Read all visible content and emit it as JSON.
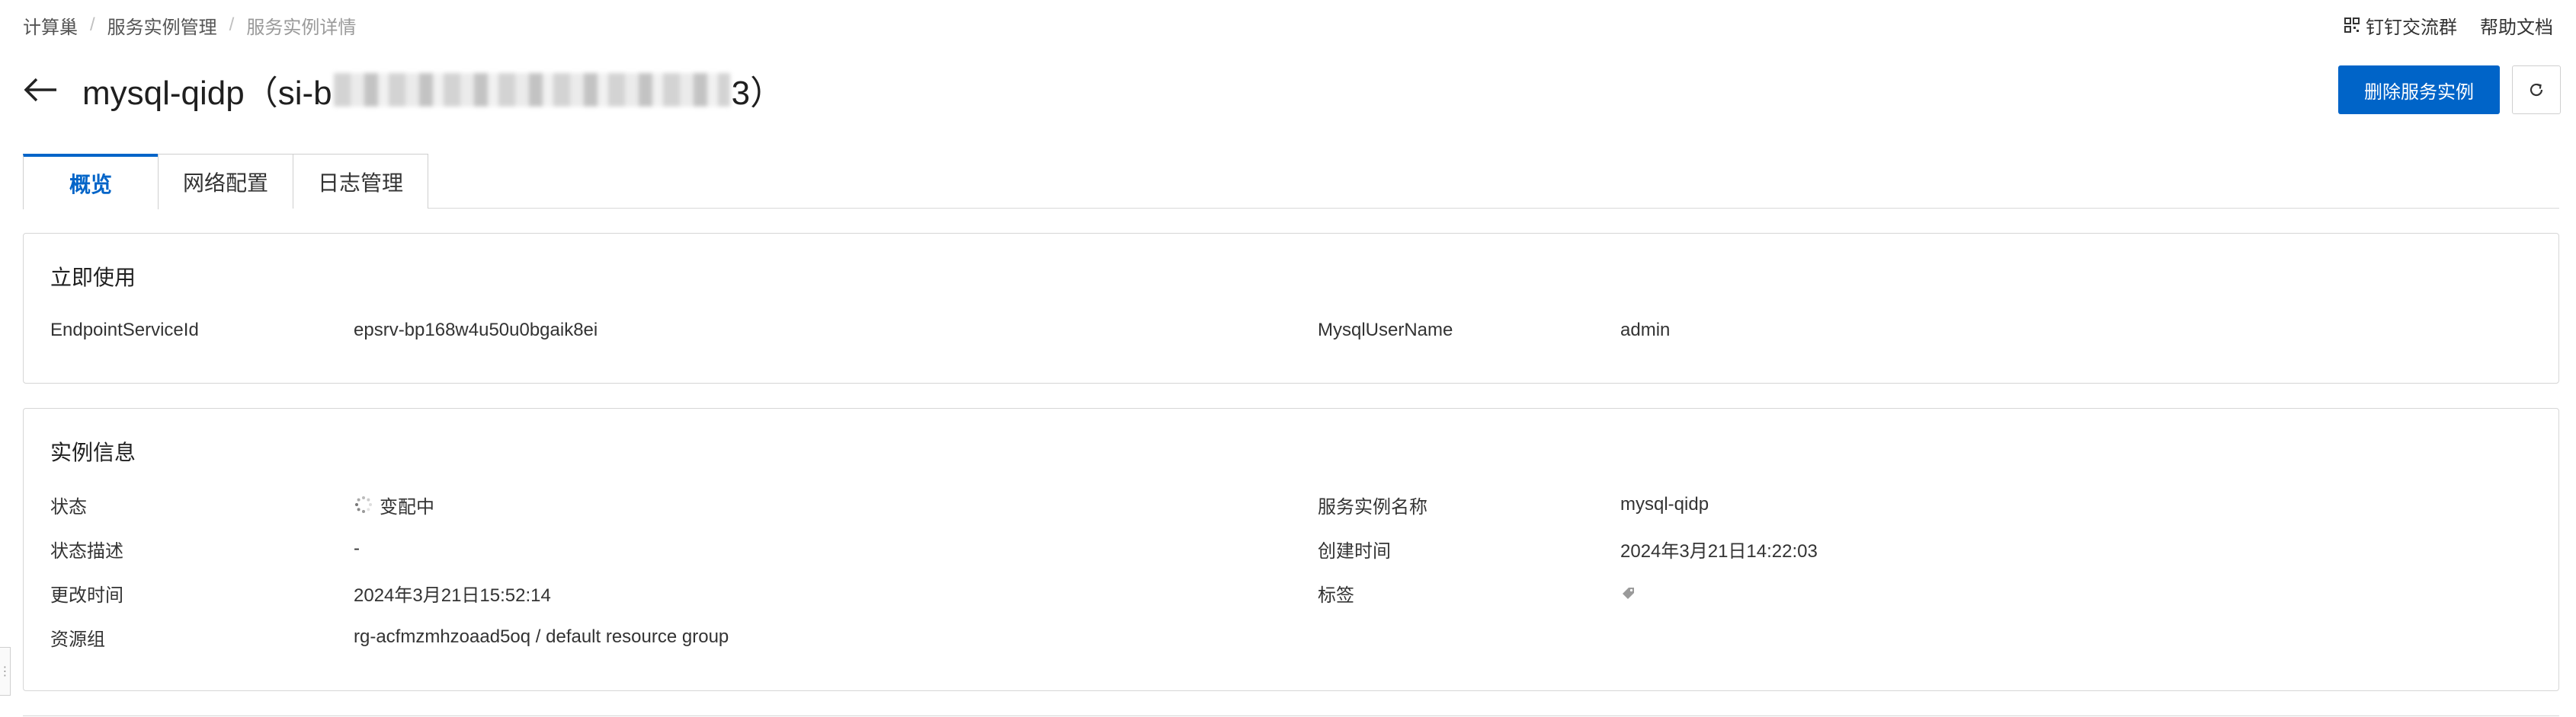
{
  "breadcrumb": {
    "items": [
      "计算巢",
      "服务实例管理",
      "服务实例详情"
    ],
    "separator": "/"
  },
  "top_links": {
    "dingtalk": "钉钉交流群",
    "help": "帮助文档"
  },
  "header": {
    "title_prefix": "mysql-qidp（si-b",
    "title_suffix": "3）",
    "delete_label": "删除服务实例",
    "accent_color": "#0064c8"
  },
  "tabs": [
    {
      "label": "概览",
      "active": true
    },
    {
      "label": "网络配置",
      "active": false
    },
    {
      "label": "日志管理",
      "active": false
    }
  ],
  "quick_use": {
    "title": "立即使用",
    "endpoint_label": "EndpointServiceId",
    "endpoint_value": "epsrv-bp168w4u50u0bgaik8ei",
    "user_label": "MysqlUserName",
    "user_value": "admin"
  },
  "instance_info": {
    "title": "实例信息",
    "status_label": "状态",
    "status_value": "变配中",
    "name_label": "服务实例名称",
    "name_value": "mysql-qidp",
    "desc_label": "状态描述",
    "desc_value": "-",
    "created_label": "创建时间",
    "created_value": "2024年3月21日14:22:03",
    "updated_label": "更改时间",
    "updated_value": "2024年3月21日15:52:14",
    "tag_label": "标签",
    "rg_label": "资源组",
    "rg_value": "rg-acfmzmhzoaad5oq / default resource group"
  },
  "icons": {
    "back": "arrow-left-icon",
    "refresh": "refresh-icon",
    "qr": "qr-code-icon",
    "spinner": "loading-spinner-icon",
    "tag": "tag-edit-icon"
  }
}
